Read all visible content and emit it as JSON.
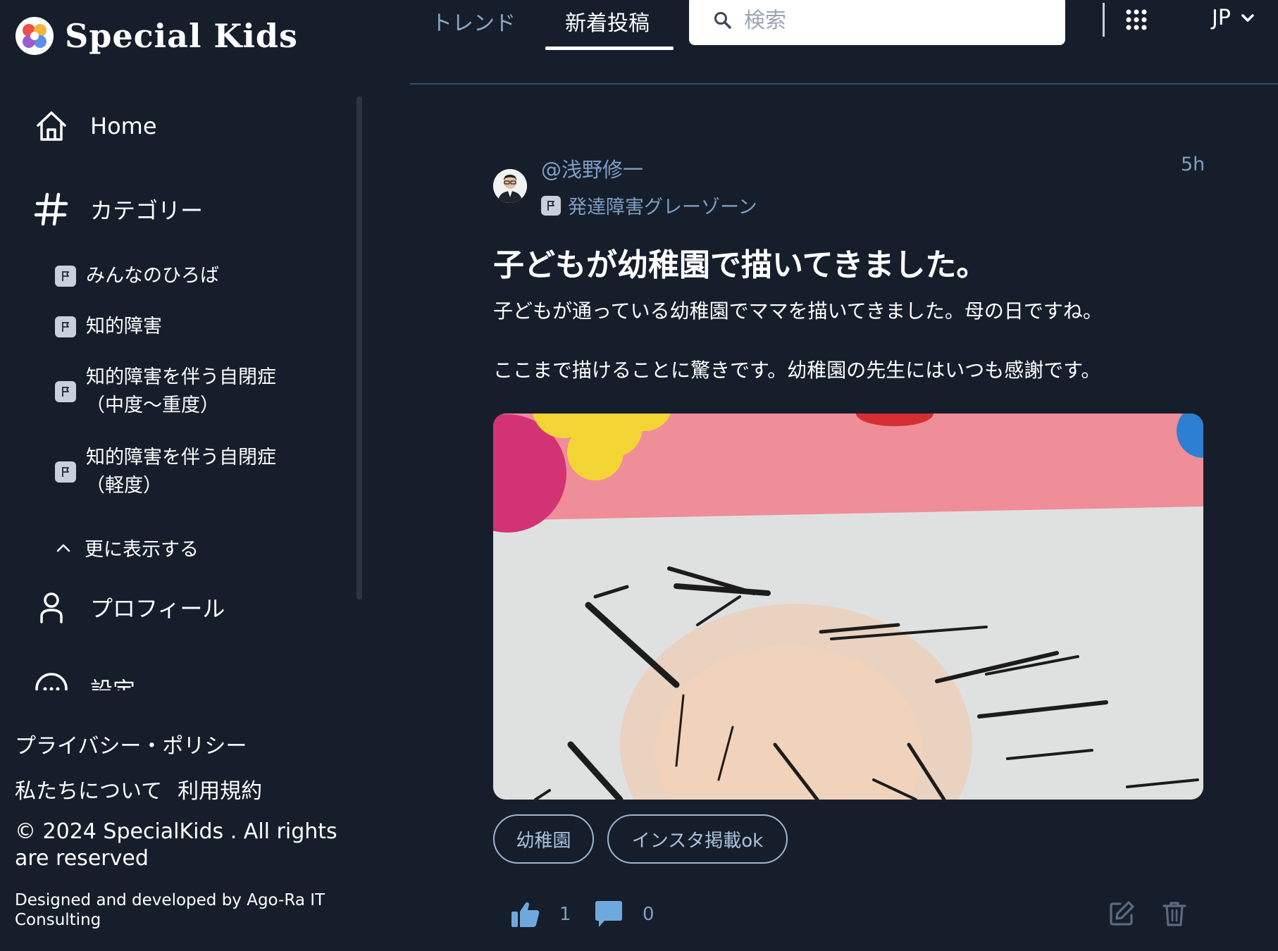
{
  "brand": {
    "name": "Special Kids"
  },
  "sidebar": {
    "nav": [
      {
        "label": "Home",
        "icon": "home-icon"
      },
      {
        "label": "カテゴリー",
        "icon": "hashtag-icon"
      },
      {
        "label": "プロフィール",
        "icon": "user-icon"
      },
      {
        "label": "設定",
        "icon": "settings-icon"
      }
    ],
    "categories": [
      {
        "line1": "みんなのひろば",
        "line2": ""
      },
      {
        "line1": "知的障害",
        "line2": ""
      },
      {
        "line1": "知的障害を伴う自閉症",
        "line2": "（中度～重度）"
      },
      {
        "line1": "知的障害を伴う自閉症",
        "line2": "（軽度）"
      }
    ],
    "more_label": "更に表示する"
  },
  "footer": {
    "privacy": "プライバシー・ポリシー",
    "about": "私たちについて",
    "terms": "利用規約",
    "copyright_line1": "© 2024 SpecialKids . All rights",
    "copyright_line2": "are reserved",
    "credit_line1": "Designed and developed by Ago-Ra IT",
    "credit_line2": "Consulting"
  },
  "header": {
    "tabs": [
      {
        "label": "トレンド",
        "active": false
      },
      {
        "label": "新着投稿",
        "active": true
      }
    ],
    "search_placeholder": "検索",
    "language": "JP"
  },
  "post": {
    "author": "@浅野修一",
    "time": "5h",
    "category": "発達障害グレーゾーン",
    "title": "子どもが幼稚園で描いてきました。",
    "body_line1": "子どもが通っている幼稚園でママを描いてきました。母の日ですね。",
    "body_line2": "ここまで描けることに驚きです。幼稚園の先生にはいつも感謝です。",
    "tags": [
      "幼稚園",
      "インスタ掲載ok"
    ],
    "likes": "1",
    "comments": "0"
  },
  "colors": {
    "background": "#161e2b",
    "accent_text": "#7f9ec4",
    "tag_border": "#9fb6cf",
    "like_icon": "#6fa8dc"
  }
}
